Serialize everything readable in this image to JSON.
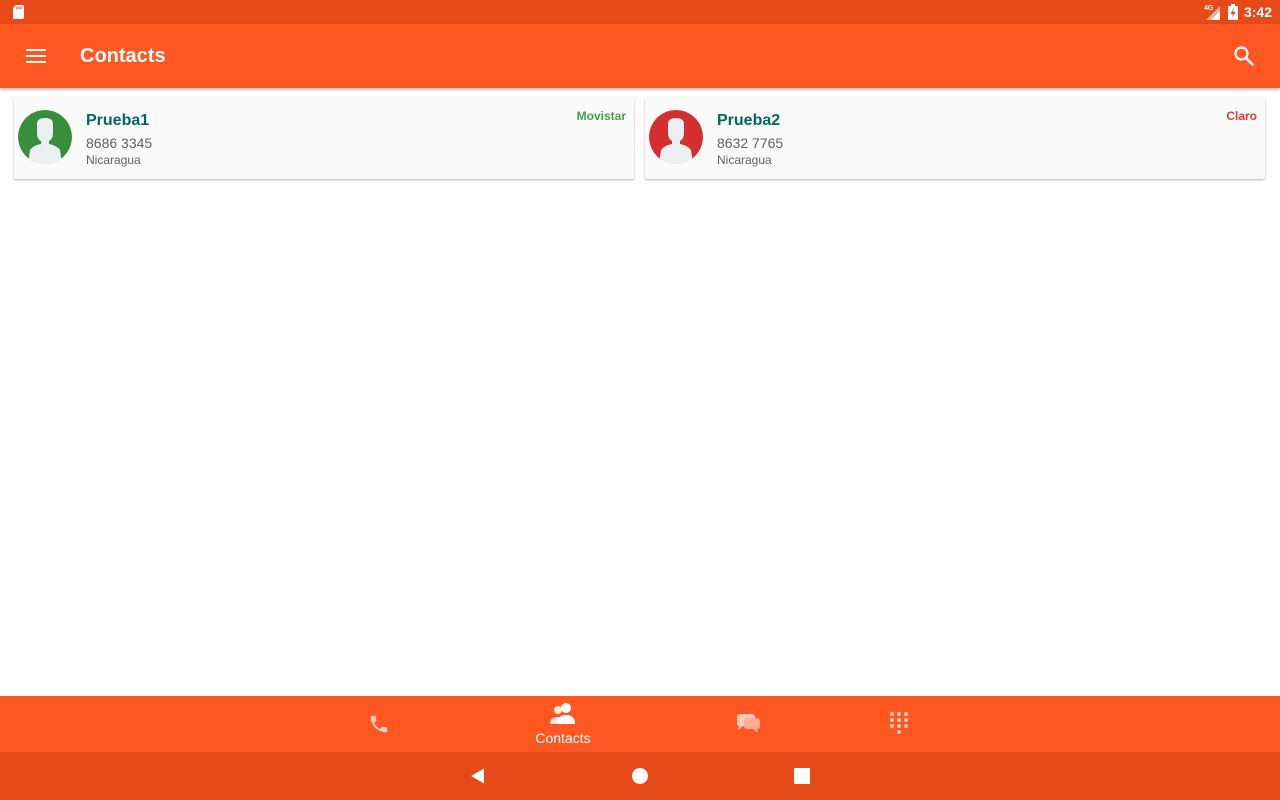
{
  "status_bar": {
    "time": "3:42",
    "network_label": "4G",
    "icons": [
      "sd-card-icon",
      "signal-icon",
      "battery-charging-icon"
    ]
  },
  "app_bar": {
    "title": "Contacts",
    "menu_icon": "menu-icon",
    "search_icon": "search-icon"
  },
  "contacts": [
    {
      "name": "Prueba1",
      "number": "8686 3345",
      "country": "Nicaragua",
      "carrier": "Movistar",
      "carrier_color": "#43A047",
      "avatar_color": "#388E3C"
    },
    {
      "name": "Prueba2",
      "number": "8632 7765",
      "country": "Nicaragua",
      "carrier": "Claro",
      "carrier_color": "#E53935",
      "avatar_color": "#D32F2F"
    }
  ],
  "bottom_nav": {
    "items": [
      {
        "icon": "phone-icon",
        "label": "",
        "active": false
      },
      {
        "icon": "contacts-icon",
        "label": "Contacts",
        "active": true
      },
      {
        "icon": "chat-icon",
        "label": "",
        "active": false
      },
      {
        "icon": "dialpad-icon",
        "label": "",
        "active": false
      }
    ]
  },
  "system_nav": {
    "icons": [
      "back-icon",
      "home-icon",
      "recents-icon"
    ]
  },
  "colors": {
    "primary": "#FF5722",
    "primary_dark": "#E64A19",
    "name_text": "#00695C"
  }
}
